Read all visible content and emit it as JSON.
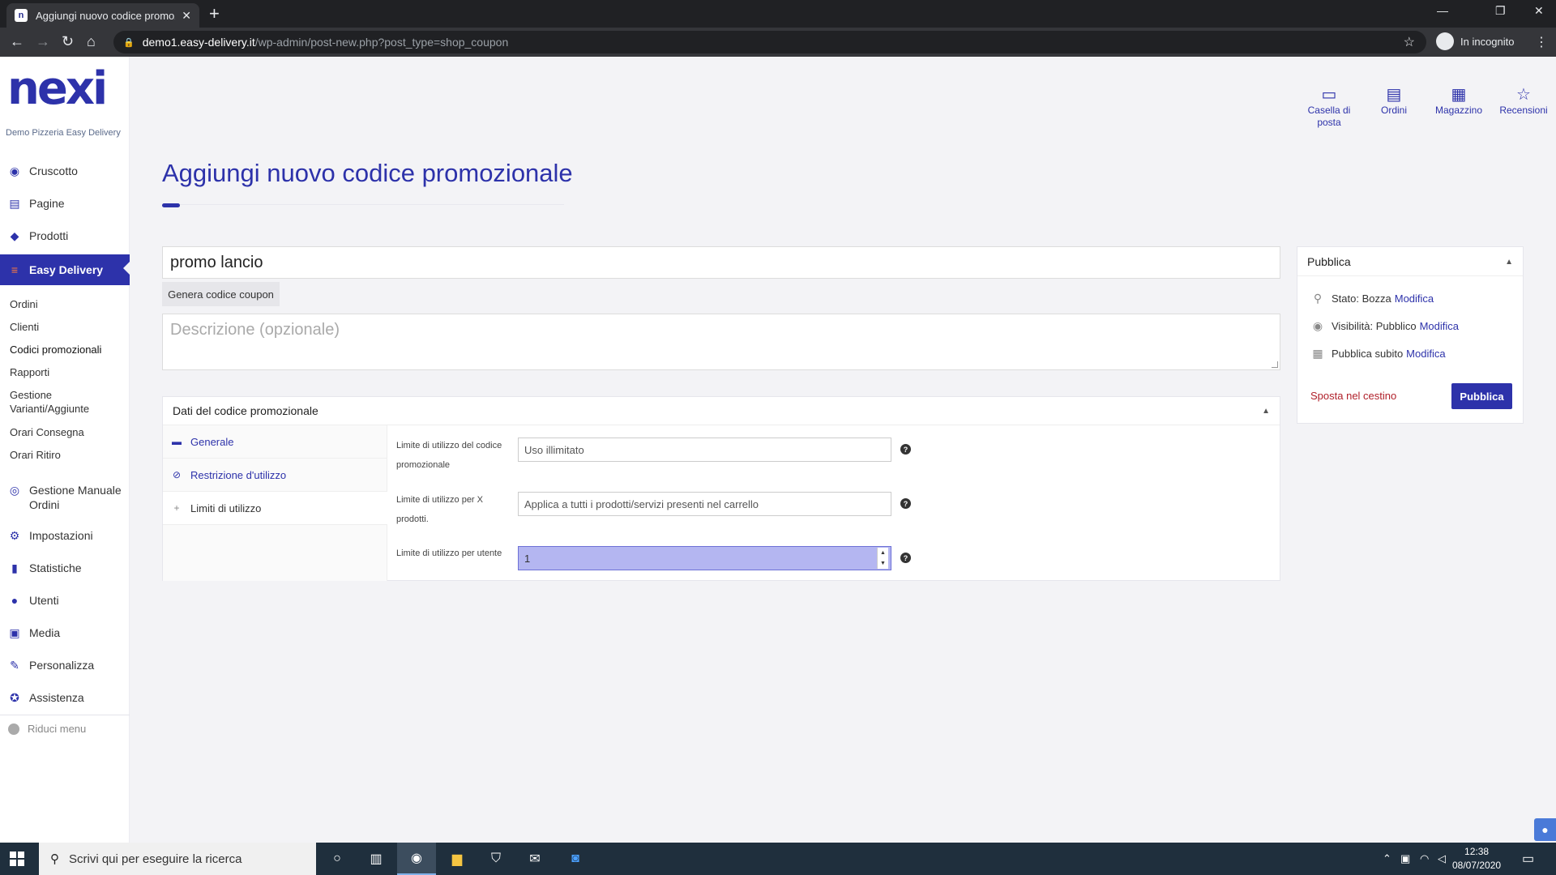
{
  "browser": {
    "tab_title": "Aggiungi nuovo codice promozio",
    "url_host": "demo1.easy-delivery.it",
    "url_path": "/wp-admin/post-new.php?post_type=shop_coupon",
    "incognito_label": "In incognito"
  },
  "sidebar": {
    "logo": "nexi",
    "site_name": "Demo Pizzeria Easy Delivery",
    "items": [
      {
        "label": "Cruscotto",
        "icon": "dashboard-icon"
      },
      {
        "label": "Pagine",
        "icon": "pages-icon"
      },
      {
        "label": "Prodotti",
        "icon": "box-icon"
      },
      {
        "label": "Easy Delivery",
        "icon": "burger-icon"
      },
      {
        "label": "Gestione Manuale Ordini",
        "icon": "eye-icon"
      },
      {
        "label": "Impostazioni",
        "icon": "gear-icon"
      },
      {
        "label": "Statistiche",
        "icon": "bar-chart-icon"
      },
      {
        "label": "Utenti",
        "icon": "user-icon"
      },
      {
        "label": "Media",
        "icon": "media-icon"
      },
      {
        "label": "Personalizza",
        "icon": "brush-icon"
      },
      {
        "label": "Assistenza",
        "icon": "lifebuoy-icon"
      }
    ],
    "sub_items": [
      "Ordini",
      "Clienti",
      "Codici promozionali",
      "Rapporti",
      "Gestione Varianti/Aggiunte",
      "Orari Consegna",
      "Orari Ritiro"
    ],
    "collapse_label": "Riduci menu"
  },
  "top_icons": [
    {
      "label": "Casella di posta",
      "icon": "inbox-icon"
    },
    {
      "label": "Ordini",
      "icon": "document-icon"
    },
    {
      "label": "Magazzino",
      "icon": "grid-icon"
    },
    {
      "label": "Recensioni",
      "icon": "star-icon"
    }
  ],
  "page": {
    "title": "Aggiungi nuovo codice promozionale",
    "coupon_code_value": "promo lancio",
    "generate_button": "Genera codice coupon",
    "description_placeholder": "Descrizione (opzionale)"
  },
  "coupon_data": {
    "header": "Dati del codice promozionale",
    "tabs": [
      "Generale",
      "Restrizione d'utilizzo",
      "Limiti di utilizzo"
    ],
    "fields": [
      {
        "label": "Limite di utilizzo del codice promozionale",
        "placeholder": "Uso illimitato",
        "value": ""
      },
      {
        "label": "Limite di utilizzo per X prodotti.",
        "placeholder": "Applica a tutti i prodotti/servizi presenti nel carrello",
        "value": ""
      },
      {
        "label": "Limite di utilizzo per utente",
        "placeholder": "",
        "value": "1"
      }
    ]
  },
  "publish": {
    "header": "Pubblica",
    "status_label": "Stato:",
    "status_value": "Bozza",
    "visibility_label": "Visibilità:",
    "visibility_value": "Pubblico",
    "schedule_label": "Pubblica subito",
    "edit_link": "Modifica",
    "trash_link": "Sposta nel cestino",
    "publish_button": "Pubblica"
  },
  "taskbar": {
    "search_placeholder": "Scrivi qui per eseguire la ricerca",
    "time": "12:38",
    "date": "08/07/2020"
  },
  "colors": {
    "brand": "#2d32aa",
    "accent": "#ff7a3d",
    "danger": "#b0202a"
  }
}
